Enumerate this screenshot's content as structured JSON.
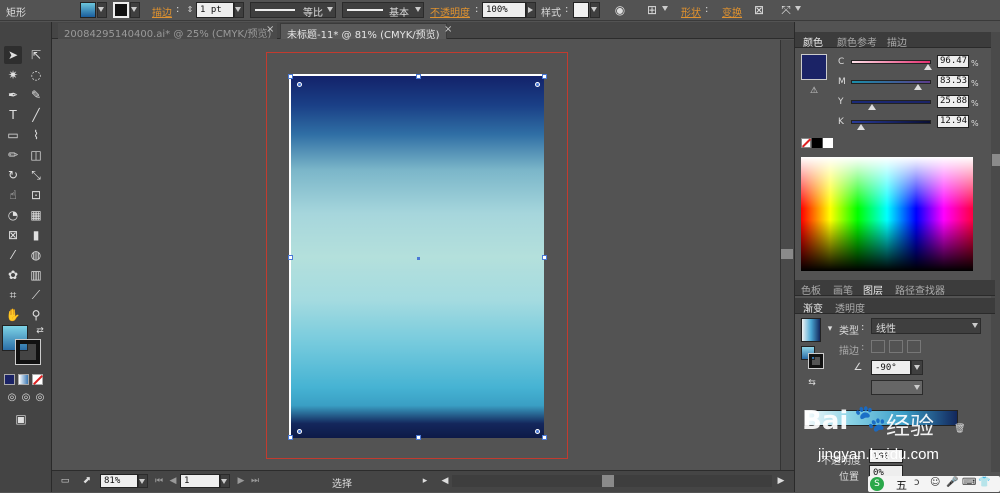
{
  "control_bar": {
    "tool_name": "矩形",
    "stroke_label": "描边",
    "stroke_weight": "1 pt",
    "profile_label": "等比",
    "brush_label": "基本",
    "opacity_label": "不透明度",
    "opacity_value": "100%",
    "style_label": "样式",
    "shape_label": "形状",
    "transform_label": "变换"
  },
  "tabs": [
    {
      "label": "20084295140400.ai* @ 25% (CMYK/预览)",
      "close": "×"
    },
    {
      "label": "未标题-11* @ 81% (CMYK/预览)",
      "close": "×"
    }
  ],
  "status_bar": {
    "zoom": "81%",
    "page": "1",
    "tool_status": "选择"
  },
  "color_panel": {
    "tabs": [
      "颜色",
      "颜色参考",
      "描边"
    ],
    "channels": [
      {
        "name": "C",
        "value": "96.47",
        "pct": 0.9647
      },
      {
        "name": "M",
        "value": "83.53",
        "pct": 0.8353
      },
      {
        "name": "Y",
        "value": "25.88",
        "pct": 0.2588
      },
      {
        "name": "K",
        "value": "12.94",
        "pct": 0.1294
      }
    ],
    "percent_sign": "%",
    "fill_color": "#1b2366"
  },
  "layers_tabs": [
    "色板",
    "画笔",
    "图层",
    "路径查找器"
  ],
  "gradient_panel": {
    "tabs": [
      "渐变",
      "透明度"
    ],
    "type_label": "类型",
    "type_value": "线性",
    "stroke_label": "描边",
    "angle_value": "-90°",
    "opacity_label": "不透明度",
    "opacity_value": "100",
    "location_label": "位置",
    "location_value": "0%"
  },
  "watermark": {
    "text": "Bai",
    "text2": "经验",
    "url": "jingyan.baidu.com"
  },
  "ime": {
    "label": "五"
  },
  "colors": {
    "accent_orange": "#e0922f",
    "artboard_red": "#c23b2f",
    "selection_blue": "#4a79d6"
  }
}
